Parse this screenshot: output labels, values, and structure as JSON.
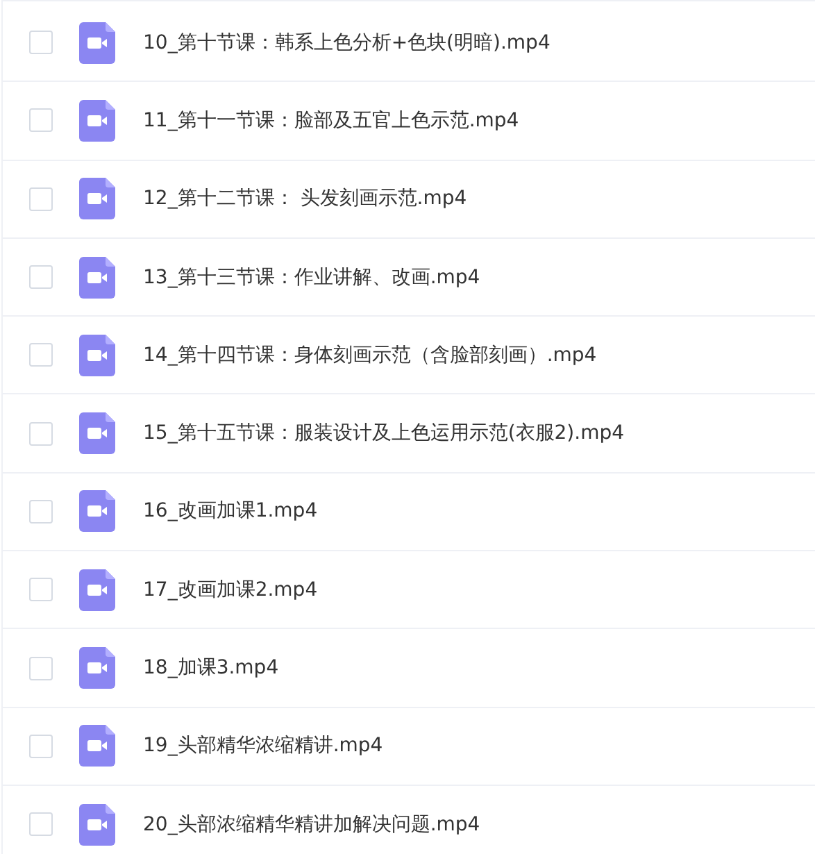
{
  "files": [
    {
      "name": "10_第十节课：韩系上色分析+色块(明暗).mp4",
      "checked": false
    },
    {
      "name": "11_第十一节课：脸部及五官上色示范.mp4",
      "checked": false
    },
    {
      "name": "12_第十二节课： 头发刻画示范.mp4",
      "checked": false
    },
    {
      "name": "13_第十三节课：作业讲解、改画.mp4",
      "checked": false
    },
    {
      "name": "14_第十四节课：身体刻画示范（含脸部刻画）.mp4",
      "checked": false
    },
    {
      "name": "15_第十五节课：服装设计及上色运用示范(衣服2).mp4",
      "checked": false
    },
    {
      "name": "16_改画加课1.mp4",
      "checked": false
    },
    {
      "name": "17_改画加课2.mp4",
      "checked": false
    },
    {
      "name": "18_加课3.mp4",
      "checked": false
    },
    {
      "name": "19_头部精华浓缩精讲.mp4",
      "checked": false
    },
    {
      "name": "20_头部浓缩精华精讲加解决问题.mp4",
      "checked": false
    }
  ]
}
